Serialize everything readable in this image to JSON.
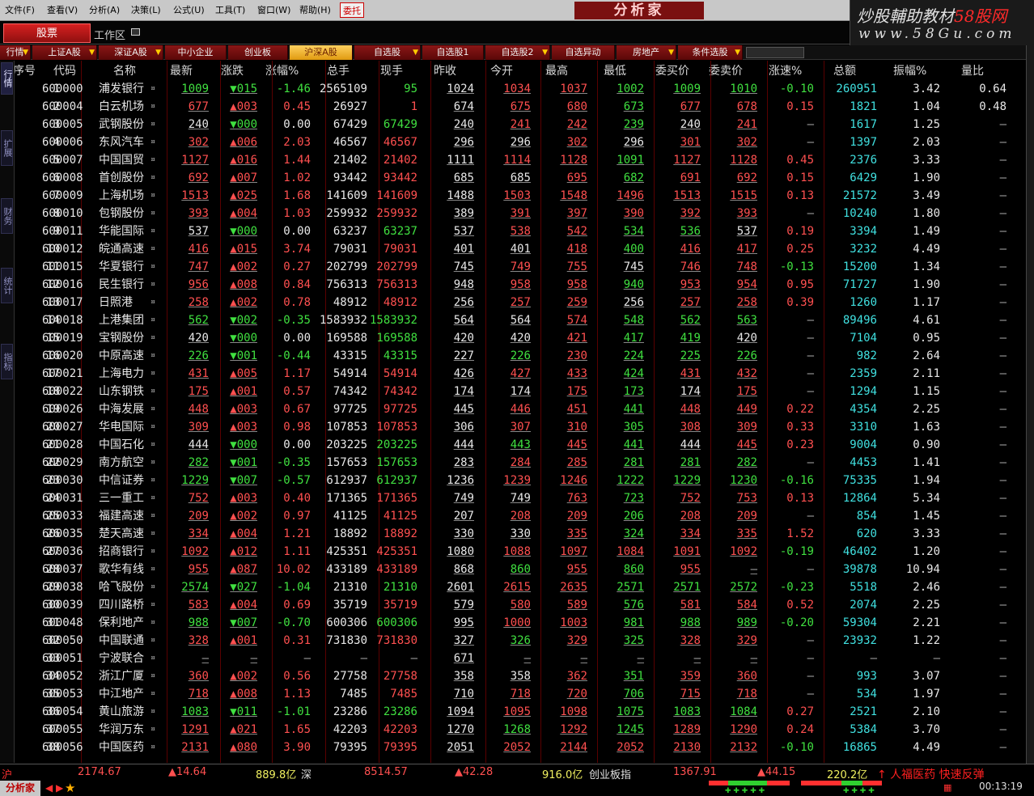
{
  "menu": {
    "items": [
      "文件(F)",
      "查看(V)",
      "分析(A)",
      "决策(L)",
      "公式(U)",
      "工具(T)",
      "窗口(W)",
      "帮助(H)"
    ],
    "entrust": "委托",
    "app_logo": "分析家"
  },
  "brand": {
    "text": "炒股輔助教材",
    "highlight": "58股网",
    "url": "www.58Gu.com"
  },
  "tabs": {
    "stock": "股票",
    "workspace": "工作区"
  },
  "boards": [
    {
      "label": "行情",
      "arrow": true
    },
    {
      "label": "上证A股",
      "arrow": true
    },
    {
      "label": "深证A股",
      "arrow": true
    },
    {
      "label": "中小企业",
      "arrow": false
    },
    {
      "label": "创业板",
      "arrow": false
    },
    {
      "label": "沪深A股",
      "arrow": false,
      "active": true
    },
    {
      "label": "自选股",
      "arrow": true
    },
    {
      "label": "自选股1",
      "arrow": false
    },
    {
      "label": "自选股2",
      "arrow": true
    },
    {
      "label": "自选异动",
      "arrow": false
    },
    {
      "label": "房地产",
      "arrow": true
    },
    {
      "label": "条件选股",
      "arrow": true
    }
  ],
  "side_tabs": [
    "行情",
    "扩展",
    "财务",
    "统计",
    "指标"
  ],
  "columns": [
    "序号",
    "代码",
    "名称",
    "最新",
    "涨跌",
    "涨幅%",
    "总手",
    "现手",
    "昨收",
    "今开",
    "最高",
    "最低",
    "委买价",
    "委卖价",
    "涨速%",
    "总额",
    "振幅%",
    "量比"
  ],
  "rows": [
    [
      "1",
      "600000",
      "浦发银行",
      "1009",
      "▼015",
      "-1.46",
      "2565109",
      "95",
      "1024",
      "1034",
      "1037",
      "1002",
      "1009",
      "1010",
      "-0.10",
      "260951",
      "3.42",
      "0.64"
    ],
    [
      "2",
      "600004",
      "白云机场",
      "677",
      "▲003",
      "0.45",
      "26927",
      "1",
      "674",
      "675",
      "680",
      "673",
      "677",
      "678",
      "0.15",
      "1821",
      "1.04",
      "0.48"
    ],
    [
      "3",
      "600005",
      "武钢股份",
      "240",
      "▼000",
      "0.00",
      "67429",
      "67429",
      "240",
      "241",
      "242",
      "239",
      "240",
      "241",
      "—",
      "1617",
      "1.25",
      "—"
    ],
    [
      "4",
      "600006",
      "东风汽车",
      "302",
      "▲006",
      "2.03",
      "46567",
      "46567",
      "296",
      "296",
      "302",
      "296",
      "301",
      "302",
      "—",
      "1397",
      "2.03",
      "—"
    ],
    [
      "5",
      "600007",
      "中国国贸",
      "1127",
      "▲016",
      "1.44",
      "21402",
      "21402",
      "1111",
      "1114",
      "1128",
      "1091",
      "1127",
      "1128",
      "0.45",
      "2376",
      "3.33",
      "—"
    ],
    [
      "6",
      "600008",
      "首创股份",
      "692",
      "▲007",
      "1.02",
      "93442",
      "93442",
      "685",
      "685",
      "695",
      "682",
      "691",
      "692",
      "0.15",
      "6429",
      "1.90",
      "—"
    ],
    [
      "7",
      "600009",
      "上海机场",
      "1513",
      "▲025",
      "1.68",
      "141609",
      "141609",
      "1488",
      "1503",
      "1548",
      "1496",
      "1513",
      "1515",
      "0.13",
      "21572",
      "3.49",
      "—"
    ],
    [
      "8",
      "600010",
      "包钢股份",
      "393",
      "▲004",
      "1.03",
      "259932",
      "259932",
      "389",
      "391",
      "397",
      "390",
      "392",
      "393",
      "—",
      "10240",
      "1.80",
      "—"
    ],
    [
      "9",
      "600011",
      "华能国际",
      "537",
      "▼000",
      "0.00",
      "63237",
      "63237",
      "537",
      "538",
      "542",
      "534",
      "536",
      "537",
      "0.19",
      "3394",
      "1.49",
      "—"
    ],
    [
      "10",
      "600012",
      "皖通高速",
      "416",
      "▲015",
      "3.74",
      "79031",
      "79031",
      "401",
      "401",
      "418",
      "400",
      "416",
      "417",
      "0.25",
      "3232",
      "4.49",
      "—"
    ],
    [
      "11",
      "600015",
      "华夏银行",
      "747",
      "▲002",
      "0.27",
      "202799",
      "202799",
      "745",
      "749",
      "755",
      "745",
      "746",
      "748",
      "-0.13",
      "15200",
      "1.34",
      "—"
    ],
    [
      "12",
      "600016",
      "民生银行",
      "956",
      "▲008",
      "0.84",
      "756313",
      "756313",
      "948",
      "958",
      "958",
      "940",
      "953",
      "954",
      "0.95",
      "71727",
      "1.90",
      "—"
    ],
    [
      "13",
      "600017",
      "日照港",
      "258",
      "▲002",
      "0.78",
      "48912",
      "48912",
      "256",
      "257",
      "259",
      "256",
      "257",
      "258",
      "0.39",
      "1260",
      "1.17",
      "—"
    ],
    [
      "14",
      "600018",
      "上港集团",
      "562",
      "▼002",
      "-0.35",
      "1583932",
      "1583932",
      "564",
      "564",
      "574",
      "548",
      "562",
      "563",
      "—",
      "89496",
      "4.61",
      "—"
    ],
    [
      "15",
      "600019",
      "宝钢股份",
      "420",
      "▼000",
      "0.00",
      "169588",
      "169588",
      "420",
      "420",
      "421",
      "417",
      "419",
      "420",
      "—",
      "7104",
      "0.95",
      "—"
    ],
    [
      "16",
      "600020",
      "中原高速",
      "226",
      "▼001",
      "-0.44",
      "43315",
      "43315",
      "227",
      "226",
      "230",
      "224",
      "225",
      "226",
      "—",
      "982",
      "2.64",
      "—"
    ],
    [
      "17",
      "600021",
      "上海电力",
      "431",
      "▲005",
      "1.17",
      "54914",
      "54914",
      "426",
      "427",
      "433",
      "424",
      "431",
      "432",
      "—",
      "2359",
      "2.11",
      "—"
    ],
    [
      "18",
      "600022",
      "山东钢铁",
      "175",
      "▲001",
      "0.57",
      "74342",
      "74342",
      "174",
      "174",
      "175",
      "173",
      "174",
      "175",
      "—",
      "1294",
      "1.15",
      "—"
    ],
    [
      "19",
      "600026",
      "中海发展",
      "448",
      "▲003",
      "0.67",
      "97725",
      "97725",
      "445",
      "446",
      "451",
      "441",
      "448",
      "449",
      "0.22",
      "4354",
      "2.25",
      "—"
    ],
    [
      "20",
      "600027",
      "华电国际",
      "309",
      "▲003",
      "0.98",
      "107853",
      "107853",
      "306",
      "307",
      "310",
      "305",
      "308",
      "309",
      "0.33",
      "3310",
      "1.63",
      "—"
    ],
    [
      "21",
      "600028",
      "中国石化",
      "444",
      "▼000",
      "0.00",
      "203225",
      "203225",
      "444",
      "443",
      "445",
      "441",
      "444",
      "445",
      "0.23",
      "9004",
      "0.90",
      "—"
    ],
    [
      "22",
      "600029",
      "南方航空",
      "282",
      "▼001",
      "-0.35",
      "157653",
      "157653",
      "283",
      "284",
      "285",
      "281",
      "281",
      "282",
      "—",
      "4453",
      "1.41",
      "—"
    ],
    [
      "23",
      "600030",
      "中信证券",
      "1229",
      "▼007",
      "-0.57",
      "612937",
      "612937",
      "1236",
      "1239",
      "1246",
      "1222",
      "1229",
      "1230",
      "-0.16",
      "75335",
      "1.94",
      "—"
    ],
    [
      "24",
      "600031",
      "三一重工",
      "752",
      "▲003",
      "0.40",
      "171365",
      "171365",
      "749",
      "749",
      "763",
      "723",
      "752",
      "753",
      "0.13",
      "12864",
      "5.34",
      "—"
    ],
    [
      "25",
      "600033",
      "福建高速",
      "209",
      "▲002",
      "0.97",
      "41125",
      "41125",
      "207",
      "208",
      "209",
      "206",
      "208",
      "209",
      "—",
      "854",
      "1.45",
      "—"
    ],
    [
      "26",
      "600035",
      "楚天高速",
      "334",
      "▲004",
      "1.21",
      "18892",
      "18892",
      "330",
      "330",
      "335",
      "324",
      "334",
      "335",
      "1.52",
      "620",
      "3.33",
      "—"
    ],
    [
      "27",
      "600036",
      "招商银行",
      "1092",
      "▲012",
      "1.11",
      "425351",
      "425351",
      "1080",
      "1088",
      "1097",
      "1084",
      "1091",
      "1092",
      "-0.19",
      "46402",
      "1.20",
      "—"
    ],
    [
      "28",
      "600037",
      "歌华有线",
      "955",
      "▲087",
      "10.02",
      "433189",
      "433189",
      "868",
      "860",
      "955",
      "860",
      "955",
      "—",
      "—",
      "39878",
      "10.94",
      "—"
    ],
    [
      "29",
      "600038",
      "哈飞股份",
      "2574",
      "▼027",
      "-1.04",
      "21310",
      "21310",
      "2601",
      "2615",
      "2635",
      "2571",
      "2571",
      "2572",
      "-0.23",
      "5518",
      "2.46",
      "—"
    ],
    [
      "30",
      "600039",
      "四川路桥",
      "583",
      "▲004",
      "0.69",
      "35719",
      "35719",
      "579",
      "580",
      "589",
      "576",
      "581",
      "584",
      "0.52",
      "2074",
      "2.25",
      "—"
    ],
    [
      "31",
      "600048",
      "保利地产",
      "988",
      "▼007",
      "-0.70",
      "600306",
      "600306",
      "995",
      "1000",
      "1003",
      "981",
      "988",
      "989",
      "-0.20",
      "59304",
      "2.21",
      "—"
    ],
    [
      "32",
      "600050",
      "中国联通",
      "328",
      "▲001",
      "0.31",
      "731830",
      "731830",
      "327",
      "326",
      "329",
      "325",
      "328",
      "329",
      "—",
      "23932",
      "1.22",
      "—"
    ],
    [
      "33",
      "600051",
      "宁波联合",
      "—",
      "—",
      "—",
      "—",
      "—",
      "671",
      "—",
      "—",
      "—",
      "—",
      "—",
      "—",
      "—",
      "—",
      "—"
    ],
    [
      "34",
      "600052",
      "浙江广厦",
      "360",
      "▲002",
      "0.56",
      "27758",
      "27758",
      "358",
      "358",
      "362",
      "351",
      "359",
      "360",
      "—",
      "993",
      "3.07",
      "—"
    ],
    [
      "35",
      "600053",
      "中江地产",
      "718",
      "▲008",
      "1.13",
      "7485",
      "7485",
      "710",
      "718",
      "720",
      "706",
      "715",
      "718",
      "—",
      "534",
      "1.97",
      "—"
    ],
    [
      "36",
      "600054",
      "黄山旅游",
      "1083",
      "▼011",
      "-1.01",
      "23286",
      "23286",
      "1094",
      "1095",
      "1098",
      "1075",
      "1083",
      "1084",
      "0.27",
      "2521",
      "2.10",
      "—"
    ],
    [
      "37",
      "600055",
      "华润万东",
      "1291",
      "▲021",
      "1.65",
      "42203",
      "42203",
      "1270",
      "1268",
      "1292",
      "1245",
      "1289",
      "1290",
      "0.24",
      "5384",
      "3.70",
      "—"
    ],
    [
      "38",
      "600056",
      "中国医药",
      "2131",
      "▲080",
      "3.90",
      "79395",
      "79395",
      "2051",
      "2052",
      "2144",
      "2052",
      "2130",
      "2132",
      "-0.10",
      "16865",
      "4.49",
      "—"
    ]
  ],
  "status": {
    "sh_label": "沪",
    "sh_index": "2174.67",
    "sh_change": "▲14.64",
    "sh_amount": "889.8亿",
    "sz_label": "深",
    "sz_index": "8514.57",
    "sz_change": "▲42.28",
    "sz_amount": "916.0亿",
    "cy_label": "创业板指",
    "cy_index": "1367.91",
    "cy_change": "▲44.15",
    "cy_amount": "220.2亿",
    "ticker": "↑ 人福医药 快速反弹",
    "time": "00:13:19",
    "logo": "分析家"
  },
  "colors": {
    "up": "#ff5050",
    "down": "#40e040",
    "flat": "#e8e8e8",
    "code": "#f0f060",
    "accent": "#c81818"
  }
}
